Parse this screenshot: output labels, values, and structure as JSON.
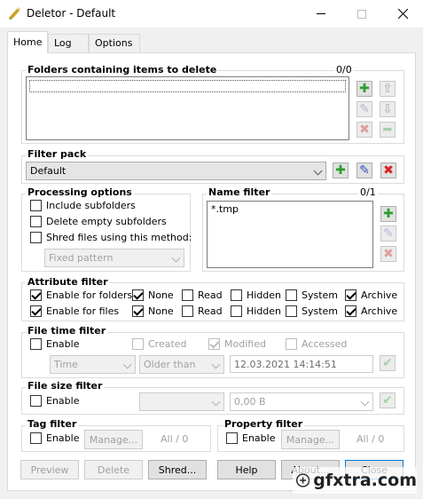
{
  "window": {
    "title": "Deletor - Default"
  },
  "tabs": [
    "Home",
    "Log",
    "Options"
  ],
  "folders": {
    "label": "Folders containing items to delete",
    "count": "0/0"
  },
  "filter_pack": {
    "label": "Filter pack",
    "selected": "Default"
  },
  "processing": {
    "label": "Processing options",
    "include_subfolders": "Include subfolders",
    "delete_empty": "Delete empty subfolders",
    "shred": "Shred files using this method:",
    "method": "Fixed pattern"
  },
  "name_filter": {
    "label": "Name filter",
    "count": "0/1",
    "items": [
      "*.tmp"
    ]
  },
  "attribute": {
    "label": "Attribute filter",
    "folders": "Enable for folders",
    "files": "Enable for files",
    "none": "None",
    "read": "Read",
    "hidden": "Hidden",
    "system": "System",
    "archive": "Archive"
  },
  "filetime": {
    "label": "File time filter",
    "enable": "Enable",
    "created": "Created",
    "modified": "Modified",
    "accessed": "Accessed",
    "unit": "Time",
    "op": "Older than",
    "date": "12.03.2021 14:14:51"
  },
  "filesize": {
    "label": "File size filter",
    "enable": "Enable",
    "value": "0,00 B"
  },
  "tag": {
    "label": "Tag filter",
    "enable": "Enable",
    "manage": "Manage...",
    "count": "All / 0"
  },
  "property": {
    "label": "Property filter",
    "enable": "Enable",
    "manage": "Manage...",
    "count": "All / 0"
  },
  "buttons": {
    "preview": "Preview",
    "delete": "Delete",
    "shred": "Shred...",
    "help": "Help",
    "about": "About...",
    "close": "Close"
  },
  "watermark": "gfxtra.com"
}
